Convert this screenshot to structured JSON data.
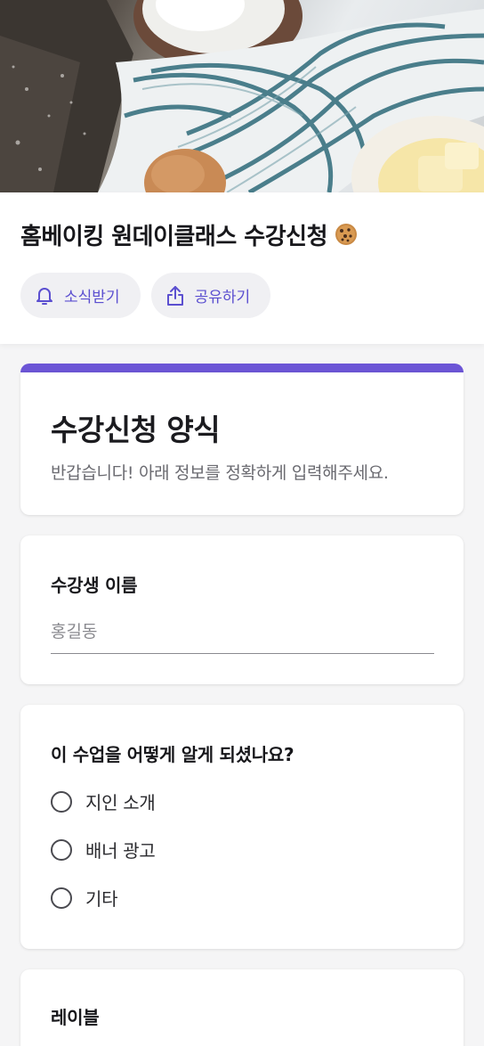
{
  "hero": {
    "icon": "baking-photo"
  },
  "header": {
    "title": "홈베이킹 원데이클래스 수강신청",
    "title_emoji_icon": "cookie-icon",
    "buttons": [
      {
        "label": "소식받기",
        "icon": "bell-icon"
      },
      {
        "label": "공유하기",
        "icon": "share-icon"
      }
    ]
  },
  "form": {
    "accent_color": "#6c55d6",
    "title": "수강신청 양식",
    "description": "반갑습니다! 아래 정보를 정확하게 입력해주세요.",
    "name_question": {
      "label": "수강생 이름",
      "placeholder": "홍길동"
    },
    "source_question": {
      "label": "이 수업을 어떻게 알게 되셨나요?",
      "options": [
        "지인 소개",
        "배너 광고",
        "기타"
      ]
    },
    "next_question": {
      "label": "레이블"
    }
  }
}
